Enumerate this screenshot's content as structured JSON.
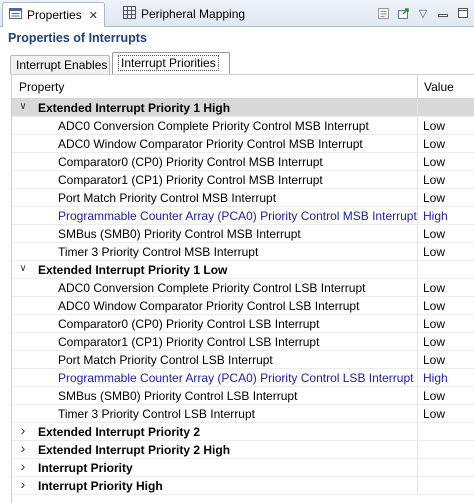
{
  "tabs": [
    {
      "label": "Properties",
      "icon": "properties-icon",
      "active": true
    },
    {
      "label": "Peripheral Mapping",
      "icon": "grid-icon",
      "active": false
    }
  ],
  "toolbar_icons": [
    "restore-defaults-icon",
    "open-icon",
    "view-menu-icon",
    "minimize-icon",
    "maximize-icon"
  ],
  "content_title": "Properties of Interrupts",
  "subtabs": [
    {
      "label": "Interrupt Enables",
      "active": false
    },
    {
      "label": "Interrupt Priorities",
      "active": true
    }
  ],
  "table": {
    "columns": [
      "Property",
      "Value"
    ],
    "rows": [
      {
        "type": "group",
        "expanded": true,
        "selected": true,
        "label": "Extended Interrupt Priority 1 High",
        "value": ""
      },
      {
        "type": "item",
        "label": "ADC0 Conversion Complete Priority Control MSB Interrupt",
        "value": "Low"
      },
      {
        "type": "item",
        "label": "ADC0 Window Comparator Priority Control MSB Interrupt",
        "value": "Low"
      },
      {
        "type": "item",
        "label": "Comparator0 (CP0) Priority Control MSB Interrupt",
        "value": "Low"
      },
      {
        "type": "item",
        "label": "Comparator1 (CP1) Priority Control MSB Interrupt",
        "value": "Low"
      },
      {
        "type": "item",
        "label": "Port Match Priority Control MSB Interrupt",
        "value": "Low"
      },
      {
        "type": "item",
        "modified": true,
        "label": "Programmable Counter Array (PCA0) Priority Control MSB Interrupt",
        "value": "High"
      },
      {
        "type": "item",
        "label": "SMBus (SMB0) Priority Control MSB Interrupt",
        "value": "Low"
      },
      {
        "type": "item",
        "label": "Timer 3 Priority Control MSB Interrupt",
        "value": "Low"
      },
      {
        "type": "group",
        "expanded": true,
        "label": "Extended Interrupt Priority 1 Low",
        "value": ""
      },
      {
        "type": "item",
        "label": "ADC0 Conversion Complete Priority Control LSB Interrupt",
        "value": "Low"
      },
      {
        "type": "item",
        "label": "ADC0 Window Comparator Priority Control LSB Interrupt",
        "value": "Low"
      },
      {
        "type": "item",
        "label": "Comparator0 (CP0) Priority Control LSB Interrupt",
        "value": "Low"
      },
      {
        "type": "item",
        "label": "Comparator1 (CP1) Priority Control LSB Interrupt",
        "value": "Low"
      },
      {
        "type": "item",
        "label": "Port Match Priority Control LSB Interrupt",
        "value": "Low"
      },
      {
        "type": "item",
        "modified": true,
        "label": "Programmable Counter Array (PCA0) Priority Control LSB Interrupt",
        "value": "High"
      },
      {
        "type": "item",
        "label": "SMBus (SMB0) Priority Control LSB Interrupt",
        "value": "Low"
      },
      {
        "type": "item",
        "label": "Timer 3 Priority Control LSB Interrupt",
        "value": "Low"
      },
      {
        "type": "group",
        "expanded": false,
        "label": "Extended Interrupt Priority 2",
        "value": ""
      },
      {
        "type": "group",
        "expanded": false,
        "label": "Extended Interrupt Priority 2 High",
        "value": ""
      },
      {
        "type": "group",
        "expanded": false,
        "label": "Interrupt Priority",
        "value": ""
      },
      {
        "type": "group",
        "expanded": false,
        "label": "Interrupt Priority High",
        "value": ""
      }
    ]
  },
  "colors": {
    "title": "#20437a",
    "modified_value": "#2020b0",
    "selected_row": "#d9d9d9"
  }
}
